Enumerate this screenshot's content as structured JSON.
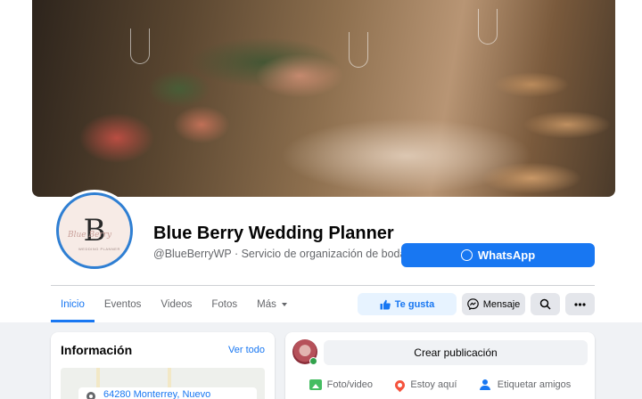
{
  "page": {
    "name": "Blue Berry Wedding Planner",
    "handle_line": "@BlueBerryWP · Servicio de organización de bodas",
    "avatar_letter": "B",
    "avatar_script": "Blue Berry",
    "avatar_small": "WEDDING PLANNER"
  },
  "actions": {
    "whatsapp_label": "WhatsApp",
    "like_label": "Te gusta",
    "message_label": "Mensaje"
  },
  "tabs": [
    {
      "label": "Inicio",
      "active": true
    },
    {
      "label": "Eventos"
    },
    {
      "label": "Videos"
    },
    {
      "label": "Fotos"
    },
    {
      "label": "Más"
    }
  ],
  "info": {
    "title": "Información",
    "see_all": "Ver todo",
    "address": "64280 Monterrey, Nuevo"
  },
  "composer": {
    "create_label": "Crear publicación",
    "actions": [
      {
        "label": "Foto/video",
        "icon": "photo-video-icon"
      },
      {
        "label": "Estoy aquí",
        "icon": "location-pin-icon"
      },
      {
        "label": "Etiquetar amigos",
        "icon": "tag-friends-icon"
      }
    ]
  },
  "colors": {
    "accent": "#1877f2",
    "background": "#f0f2f5",
    "secondary_text": "#65676b"
  }
}
